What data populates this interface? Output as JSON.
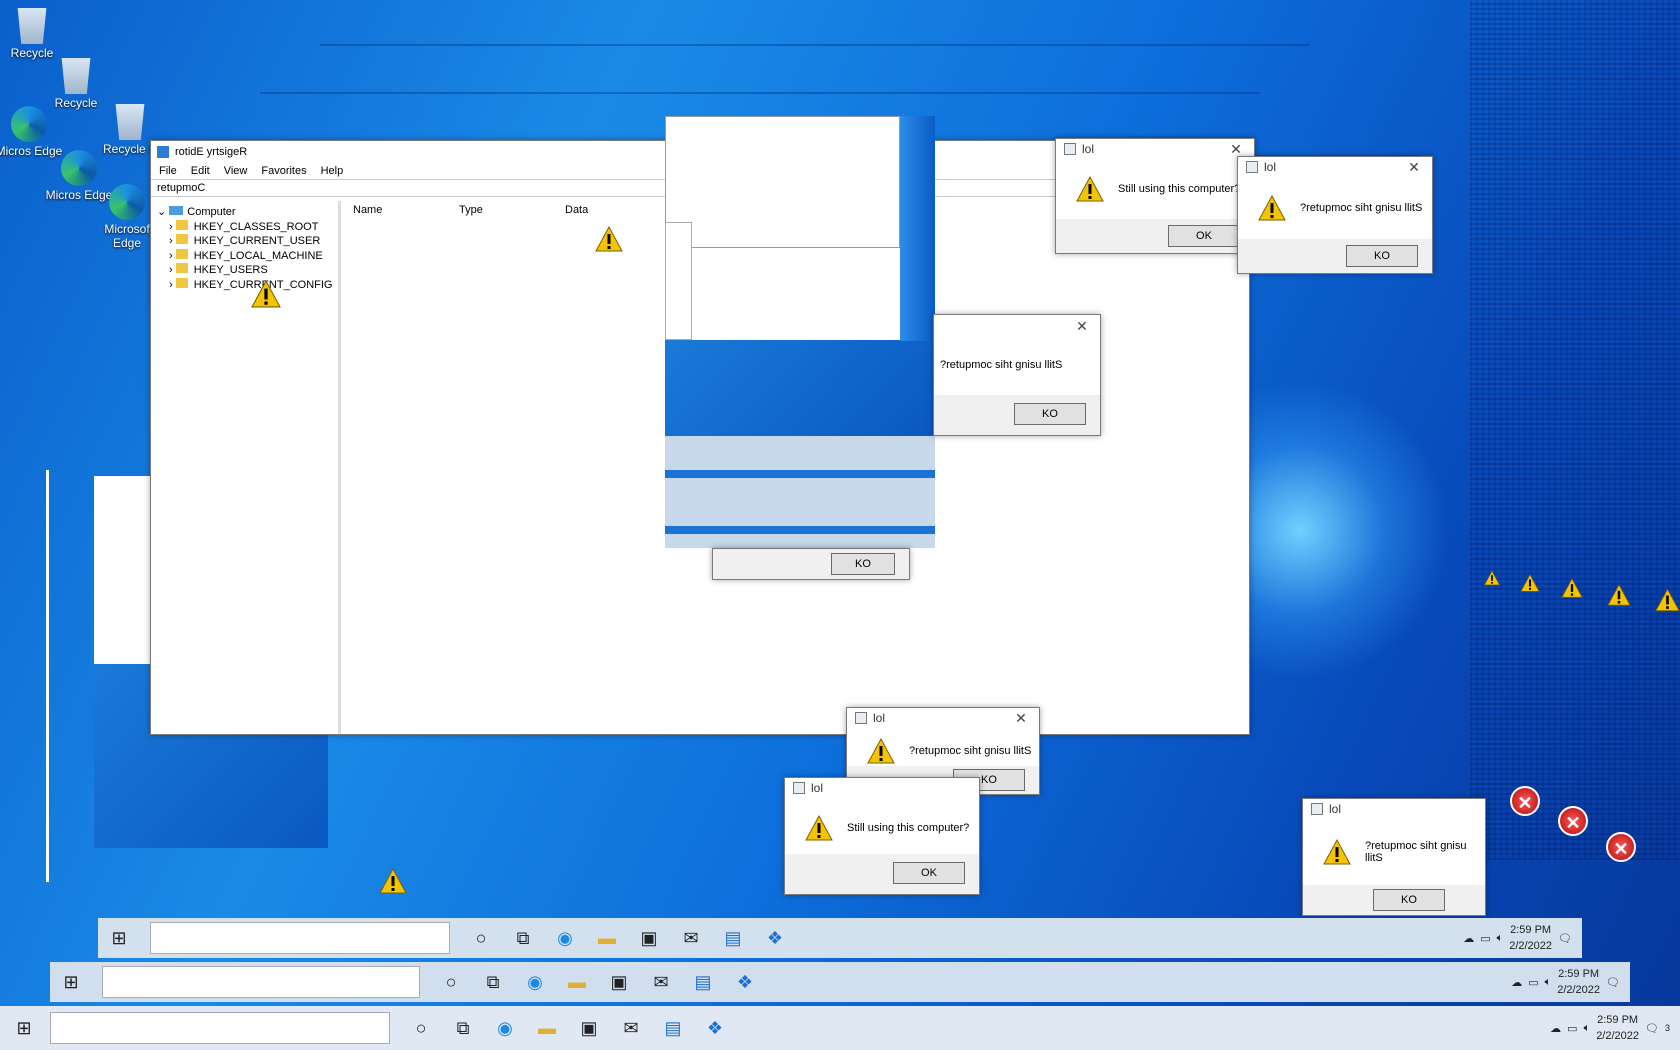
{
  "desktop": {
    "icons": [
      {
        "label": "Recycle",
        "type": "bin"
      },
      {
        "label": "Recycle",
        "type": "bin"
      },
      {
        "label": "Recycle B",
        "type": "bin"
      },
      {
        "label": "Micros Edge",
        "type": "edge"
      },
      {
        "label": "Micros Edge",
        "type": "edge"
      },
      {
        "label": "Microsof Edge",
        "type": "edge"
      }
    ]
  },
  "regedit": {
    "title": "rotidE yrtsigeR",
    "menu": [
      "File",
      "Edit",
      "View",
      "Favorites",
      "Help"
    ],
    "address": "retupmoC",
    "tree_root": "Computer",
    "tree_items": [
      "HKEY_CLASSES_ROOT",
      "HKEY_CURRENT_USER",
      "HKEY_LOCAL_MACHINE",
      "HKEY_USERS",
      "HKEY_CURRENT_CONFIG"
    ],
    "columns": [
      "Name",
      "Type",
      "Data"
    ]
  },
  "dialogs": [
    {
      "title": "lol",
      "message": "Still using this computer?",
      "button": "OK"
    },
    {
      "title": "lol",
      "message": "?retupmoc siht gnisu llitS",
      "button": "KO"
    },
    {
      "title": "",
      "message": "?retupmoc siht gnisu llitS",
      "button": "KO"
    },
    {
      "title": "",
      "message": "",
      "button": "KO"
    },
    {
      "title": "lol",
      "message": "?retupmoc siht gnisu llitS",
      "button": "KO"
    },
    {
      "title": "lol",
      "message": "Still using this computer?",
      "button": "OK"
    },
    {
      "title": "lol",
      "message": "?retupmoc siht gnisu llitS",
      "button": "KO"
    }
  ],
  "taskbar": {
    "time": "2:59 PM",
    "date": "2/2/2022",
    "notification_count": "3"
  },
  "colors": {
    "warning": "#f5c400",
    "error": "#c41010",
    "desktop": "#0d6edb"
  }
}
